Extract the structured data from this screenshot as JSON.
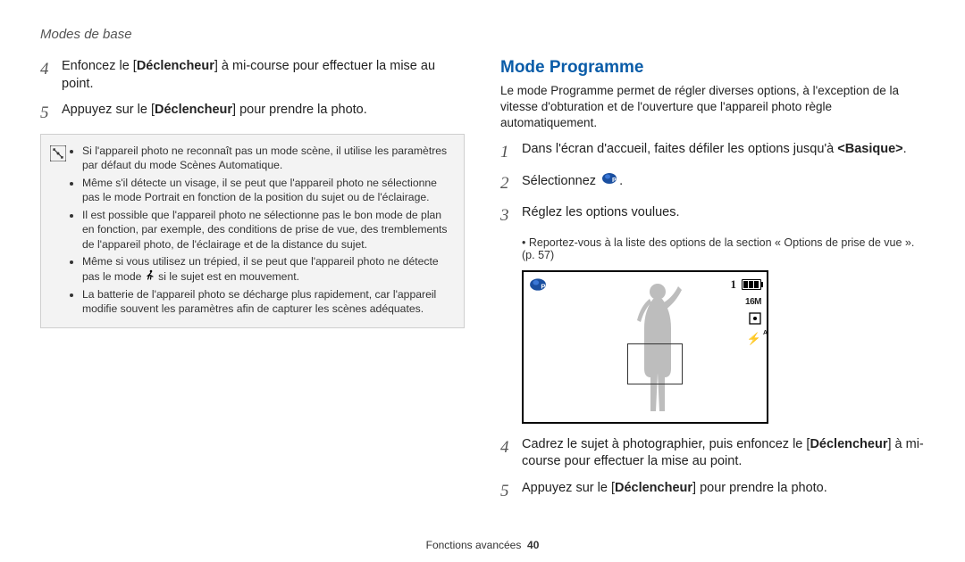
{
  "header": {
    "title": "Modes de base"
  },
  "left": {
    "step4_num": "4",
    "step4_prefix": "Enfoncez le [",
    "step4_bold": "Déclencheur",
    "step4_suffix": "] à mi-course pour effectuer la mise au point.",
    "step5_num": "5",
    "step5_prefix": "Appuyez sur le [",
    "step5_bold": "Déclencheur",
    "step5_suffix": "] pour prendre la photo.",
    "notes": {
      "n1": "Si l'appareil photo ne reconnaît pas un mode scène, il utilise les paramètres par défaut du mode Scènes Automatique.",
      "n2": "Même s'il détecte un visage, il se peut que l'appareil photo ne sélectionne pas le mode Portrait en fonction de la position du sujet ou de l'éclairage.",
      "n3": "Il est possible que l'appareil photo ne sélectionne pas le bon mode de plan en fonction, par exemple, des conditions de prise de vue, des tremblements de l'appareil photo, de l'éclairage et de la distance du sujet.",
      "n4_a": "Même si vous utilisez un trépied, il se peut que l'appareil photo ne détecte pas le mode ",
      "n4_b": " si le sujet est en mouvement.",
      "n5": "La batterie de l'appareil photo se décharge plus rapidement, car l'appareil modifie souvent les paramètres afin de capturer les scènes adéquates."
    }
  },
  "right": {
    "title": "Mode Programme",
    "intro": "Le mode Programme permet de régler diverses options, à l'exception de la vitesse d'obturation et de l'ouverture que l'appareil photo règle automatiquement.",
    "step1_num": "1",
    "step1_a": "Dans l'écran d'accueil, faites défiler les options jusqu'à ",
    "step1_b": "<Basique>",
    "step1_c": ".",
    "step2_num": "2",
    "step2_a": "Sélectionnez ",
    "step2_c": ".",
    "step3_num": "3",
    "step3": "Réglez les options voulues.",
    "step3_note_a": "Reportez-vous à la liste des options de la section « Options de prise de vue ». (p. ",
    "step3_note_page": "57",
    "step3_note_b": ")",
    "screen": {
      "mode_icon_name": "program-mode-icon",
      "counter": "1",
      "size_label": "16M",
      "metering_icon_name": "metering-icon",
      "flash_label": "A"
    },
    "step4_num": "4",
    "step4_a": "Cadrez le sujet à photographier, puis enfoncez le [",
    "step4_bold": "Déclencheur",
    "step4_b": "] à mi-course pour effectuer la mise au point.",
    "step5_num": "5",
    "step5_a": "Appuyez sur le [",
    "step5_bold": "Déclencheur",
    "step5_b": "] pour prendre la photo."
  },
  "footer": {
    "section": "Fonctions avancées",
    "page": "40"
  }
}
